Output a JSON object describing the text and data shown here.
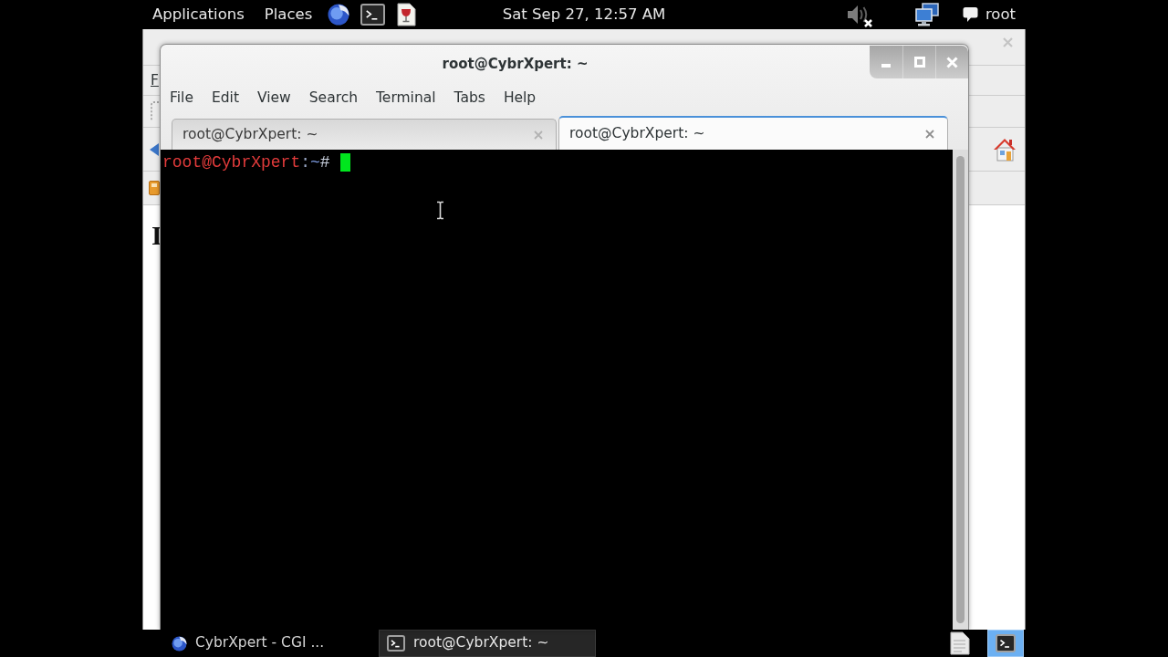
{
  "top_panel": {
    "menus": [
      "Applications",
      "Places"
    ],
    "clock": "Sat Sep 27, 12:57 AM",
    "volume": {
      "muted": true
    },
    "user": "root"
  },
  "browser_window": {
    "menu_fragment": "F",
    "heading_fragment": "I"
  },
  "terminal": {
    "title": "root@CybrXpert: ~",
    "menu": [
      "File",
      "Edit",
      "View",
      "Search",
      "Terminal",
      "Tabs",
      "Help"
    ],
    "tabs": [
      {
        "label": "root@CybrXpert: ~",
        "selected": false
      },
      {
        "label": "root@CybrXpert: ~",
        "selected": true
      }
    ],
    "prompt": {
      "user_host": "root@CybrXpert",
      "separator": ":",
      "path": "~",
      "symbol": "#"
    }
  },
  "taskbar": {
    "items": [
      {
        "kind": "browser",
        "label": "CybrXpert - CGI ...",
        "selected": false
      },
      {
        "kind": "terminal",
        "label": "root@CybrXpert: ~",
        "selected": true
      }
    ],
    "tray": [
      {
        "kind": "document",
        "selected": false
      },
      {
        "kind": "terminal",
        "selected": true
      }
    ]
  }
}
